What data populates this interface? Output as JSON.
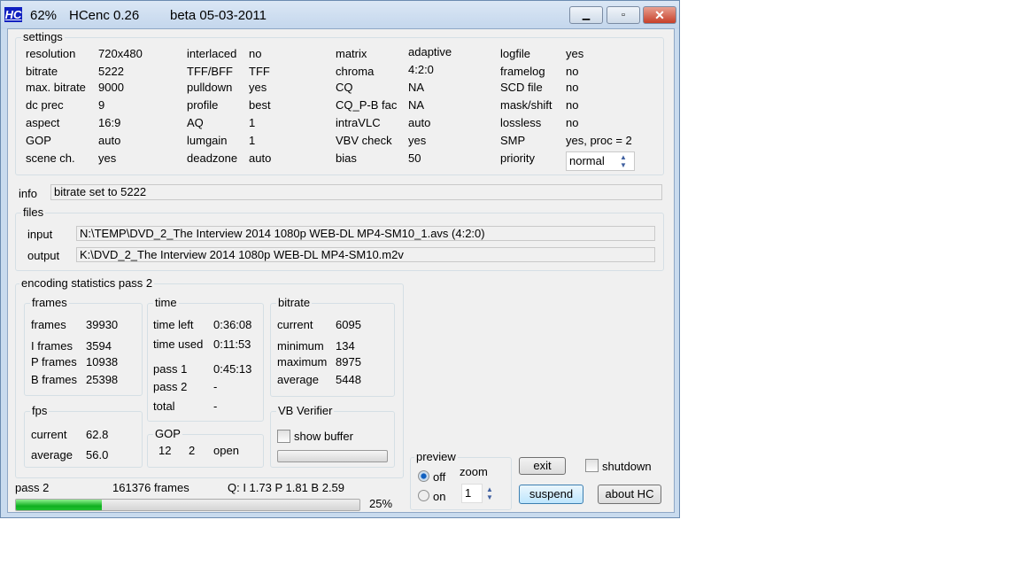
{
  "window": {
    "icon_text": "HC",
    "progress_title": "62%",
    "app_name": "HCenc 0.26",
    "version": "beta 05-03-2011"
  },
  "settings": {
    "title": "settings",
    "rows": [
      [
        [
          "resolution",
          "720x480"
        ],
        [
          "interlaced",
          "no"
        ],
        [
          "matrix",
          "adaptive"
        ],
        [
          "logfile",
          "yes"
        ]
      ],
      [
        [
          "bitrate",
          "5222"
        ],
        [
          "TFF/BFF",
          "TFF"
        ],
        [
          "chroma",
          "4:2:0"
        ],
        [
          "framelog",
          "no"
        ]
      ],
      [
        [
          "max. bitrate",
          "9000"
        ],
        [
          "pulldown",
          "yes"
        ],
        [
          "CQ",
          "NA"
        ],
        [
          "SCD file",
          "no"
        ]
      ],
      [
        [
          "dc prec",
          "9"
        ],
        [
          "profile",
          "best"
        ],
        [
          "CQ_P-B fac",
          "NA"
        ],
        [
          "mask/shift",
          "no"
        ]
      ],
      [
        [
          "aspect",
          "16:9"
        ],
        [
          "AQ",
          "1"
        ],
        [
          "intraVLC",
          "auto"
        ],
        [
          "lossless",
          "no"
        ]
      ],
      [
        [
          "GOP",
          "auto"
        ],
        [
          "lumgain",
          "1"
        ],
        [
          "VBV check",
          "yes"
        ],
        [
          "SMP",
          "yes,  proc = 2"
        ]
      ],
      [
        [
          "scene ch.",
          "yes"
        ],
        [
          "deadzone",
          "auto"
        ],
        [
          "bias",
          "50"
        ],
        [
          "priority",
          ""
        ]
      ]
    ],
    "priority_value": "normal"
  },
  "info": {
    "label": "info",
    "value": "bitrate set to  5222"
  },
  "files": {
    "title": "files",
    "input_label": "input",
    "input_value": "N:\\TEMP\\DVD_2_The Interview 2014 1080p WEB-DL MP4-SM10_1.avs   (4:2:0)",
    "output_label": "output",
    "output_value": "K:\\DVD_2_The Interview 2014 1080p WEB-DL MP4-SM10.m2v"
  },
  "stats": {
    "title": "encoding statistics pass 2",
    "frames": {
      "title": "frames",
      "items": [
        [
          "frames",
          "39930"
        ],
        [
          "I frames",
          "3594"
        ],
        [
          "P frames",
          "10938"
        ],
        [
          "B frames",
          "25398"
        ]
      ]
    },
    "fps": {
      "title": "fps",
      "items": [
        [
          "current",
          "62.8"
        ],
        [
          "average",
          "56.0"
        ]
      ]
    },
    "time": {
      "title": "time",
      "items": [
        [
          "time left",
          "0:36:08"
        ],
        [
          "time used",
          "0:11:53"
        ],
        [
          "pass 1",
          "0:45:13"
        ],
        [
          "pass 2",
          "-"
        ],
        [
          "total",
          "-"
        ]
      ]
    },
    "gop": {
      "title": "GOP",
      "n": "12",
      "m": "2",
      "type": "open"
    },
    "bitrate": {
      "title": "bitrate",
      "items": [
        [
          "current",
          "6095"
        ],
        [
          "minimum",
          "134"
        ],
        [
          "maximum",
          "8975"
        ],
        [
          "average",
          "5448"
        ]
      ]
    },
    "vbv": {
      "title": "VB Verifier",
      "show_buffer": "show buffer"
    }
  },
  "status": {
    "pass": "pass 2",
    "frames": "161376  frames",
    "q": "Q:  I 1.73   P 1.81   B 2.59",
    "percent": "25%",
    "progress": 25
  },
  "preview": {
    "title": "preview",
    "off": "off",
    "on": "on",
    "zoom_label": "zoom",
    "zoom_value": "1"
  },
  "buttons": {
    "exit": "exit",
    "shutdown": "shutdown",
    "suspend": "suspend",
    "about": "about  HC"
  }
}
